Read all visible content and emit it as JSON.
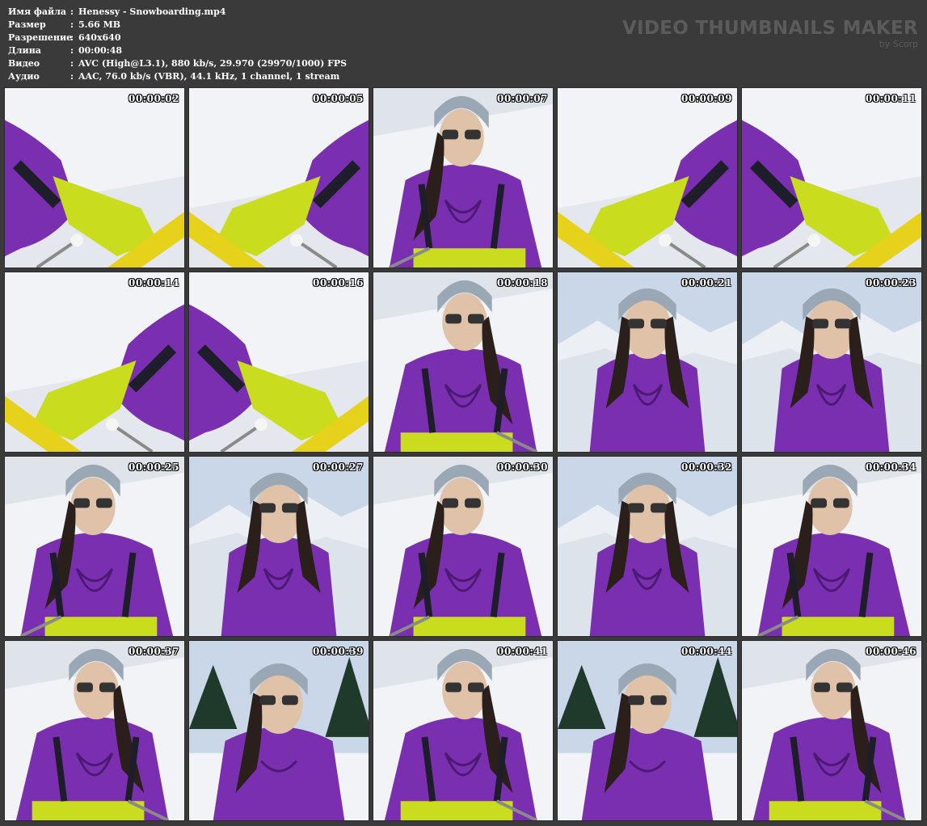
{
  "file_info": [
    {
      "key": "Имя файла",
      "sep": ":",
      "value": "Henessy - Snowboarding.mp4"
    },
    {
      "key": "Размер",
      "sep": ":",
      "value": "5.66 MB"
    },
    {
      "key": "Разрешение",
      "sep": ":",
      "value": "640x640"
    },
    {
      "key": "Длина",
      "sep": ":",
      "value": "00:00:48"
    },
    {
      "key": "Видео",
      "sep": ":",
      "value": "AVC (High@L3.1), 880 kb/s, 29.970 (29970/1000) FPS"
    },
    {
      "key": "Аудио",
      "sep": ":",
      "value": "AAC, 76.0 kb/s (VBR), 44.1 kHz, 1 channel, 1 stream"
    }
  ],
  "brand": {
    "title": "VIDEO THUMBNAILS MAKER",
    "subtitle": "by Scorp"
  },
  "thumbnails": [
    {
      "time": "00:00:02",
      "scene": "board"
    },
    {
      "time": "00:00:05",
      "scene": "board"
    },
    {
      "time": "00:00:07",
      "scene": "face"
    },
    {
      "time": "00:00:09",
      "scene": "board"
    },
    {
      "time": "00:00:11",
      "scene": "board"
    },
    {
      "time": "00:00:14",
      "scene": "board"
    },
    {
      "time": "00:00:16",
      "scene": "board"
    },
    {
      "time": "00:00:18",
      "scene": "face"
    },
    {
      "time": "00:00:21",
      "scene": "mountain"
    },
    {
      "time": "00:00:23",
      "scene": "mountain"
    },
    {
      "time": "00:00:25",
      "scene": "face"
    },
    {
      "time": "00:00:27",
      "scene": "mountain"
    },
    {
      "time": "00:00:30",
      "scene": "face"
    },
    {
      "time": "00:00:32",
      "scene": "mountain"
    },
    {
      "time": "00:00:34",
      "scene": "face"
    },
    {
      "time": "00:00:37",
      "scene": "face"
    },
    {
      "time": "00:00:39",
      "scene": "trees"
    },
    {
      "time": "00:00:41",
      "scene": "face"
    },
    {
      "time": "00:00:44",
      "scene": "trees"
    },
    {
      "time": "00:00:46",
      "scene": "face"
    }
  ],
  "colors": {
    "background": "#3a3a3a",
    "hoodie": "#7a2fb0",
    "pants": "#c9dc1e",
    "board": "#e6d21a",
    "beanie": "#9aa7b4",
    "snow": "#f2f3f7",
    "sky": "#c9d7e8"
  }
}
